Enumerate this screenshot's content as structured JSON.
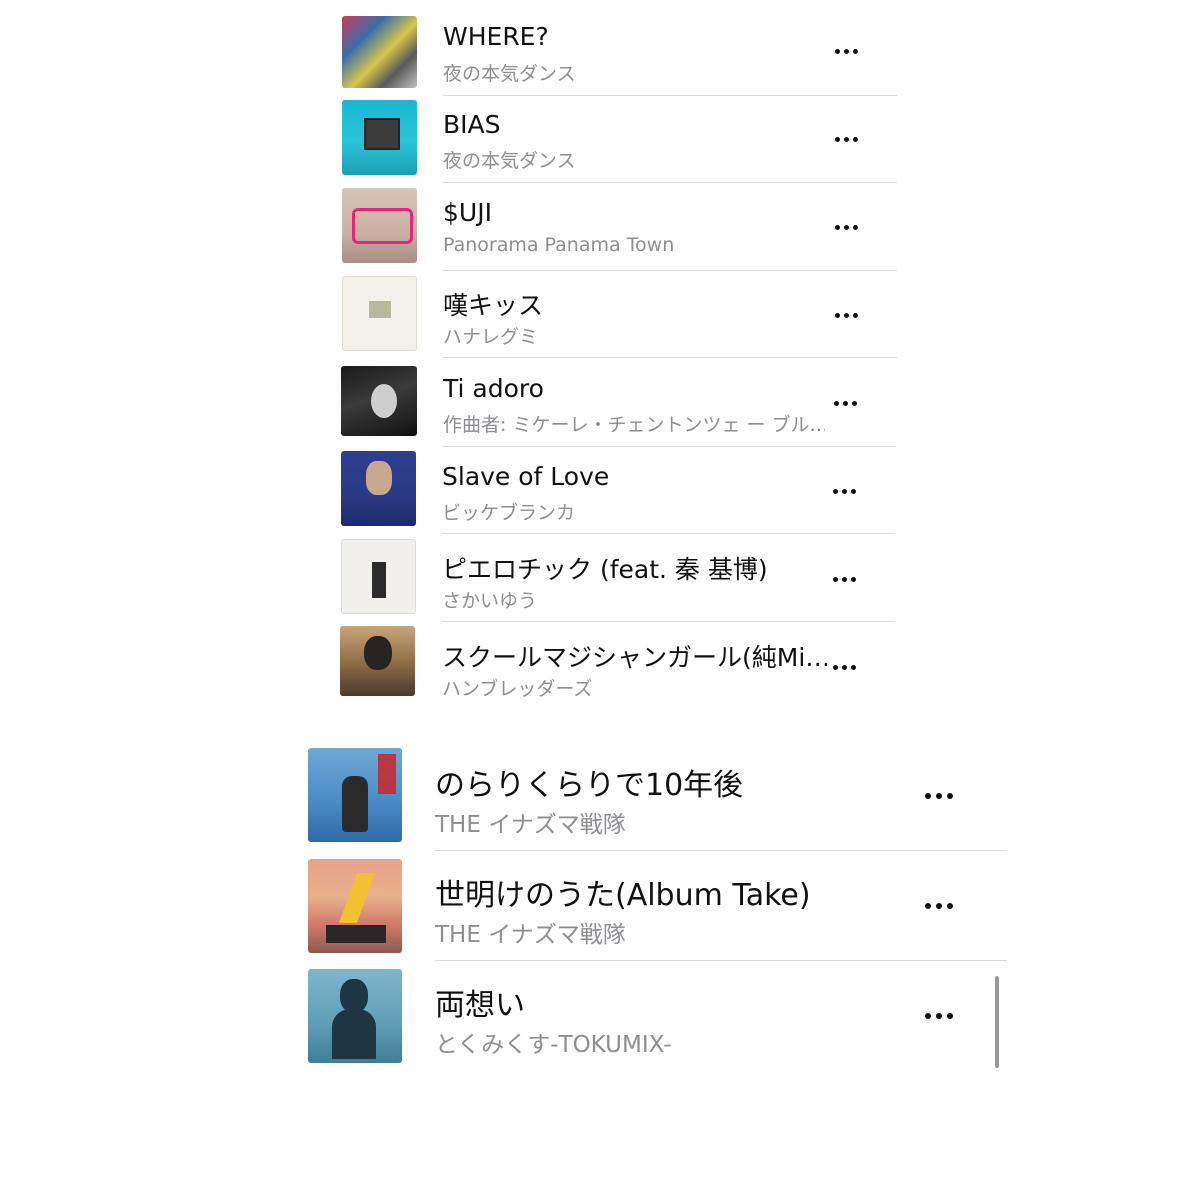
{
  "list_top": {
    "songs": [
      {
        "title": "WHERE?",
        "artist": "夜の本気ダンス",
        "art": "art-where"
      },
      {
        "title": "BIAS",
        "artist": "夜の本気ダンス",
        "art": "art-bias"
      },
      {
        "title": "$UJI",
        "artist": "Panorama Panama Town",
        "art": "art-suji"
      },
      {
        "title": "嘆キッス",
        "artist": "ハナレグミ",
        "art": "art-nagekiss"
      },
      {
        "title": "Ti adoro",
        "artist": "作曲者: ミケーレ・チェントンツェ ー ブル…",
        "art": "art-tiadoro"
      },
      {
        "title": "Slave of Love",
        "artist": "ビッケブランカ",
        "art": "art-slave"
      },
      {
        "title": "ピエロチック (feat. 秦 基博)",
        "artist": "さかいゆう",
        "art": "art-pierrot"
      },
      {
        "title": "スクールマジシャンガール(純Mi…",
        "artist": "ハンブレッダーズ",
        "art": "art-school"
      }
    ]
  },
  "list_bottom": {
    "songs": [
      {
        "title": "のらりくらりで10年後",
        "artist": "THE イナズマ戦隊",
        "art": "art-norari"
      },
      {
        "title": "世明けのうた(Album Take)",
        "artist": "THE イナズマ戦隊",
        "art": "art-yoake"
      },
      {
        "title": "両想い",
        "artist": "とくみくす-TOKUMIX-",
        "art": "art-ryoomoi"
      }
    ]
  },
  "icons": {
    "more": "ellipsis-icon"
  },
  "colors": {
    "title": "#111111",
    "subtitle": "#8e8e93",
    "separator": "#dcdcdc"
  }
}
